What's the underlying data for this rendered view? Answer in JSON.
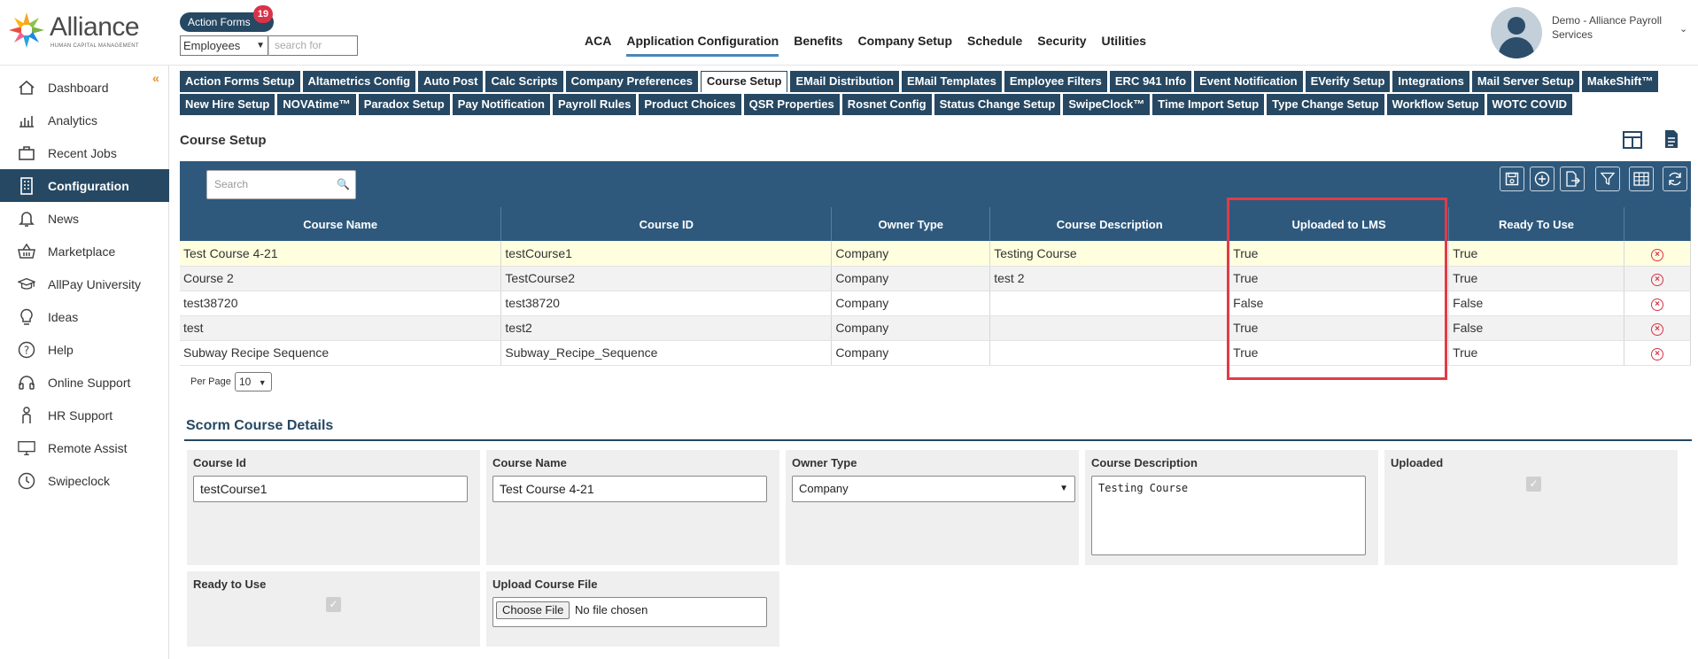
{
  "brand": {
    "name": "Alliance",
    "tagline": "HUMAN CAPITAL MANAGEMENT"
  },
  "header": {
    "action_forms_label": "Action Forms",
    "action_forms_count": "19",
    "employee_select": "Employees",
    "search_placeholder": "search for",
    "nav": [
      "ACA",
      "Application Configuration",
      "Benefits",
      "Company Setup",
      "Schedule",
      "Security",
      "Utilities"
    ],
    "user_name": "Demo - Alliance Payroll Services"
  },
  "sidebar": {
    "items": [
      {
        "label": "Dashboard",
        "icon": "home-icon"
      },
      {
        "label": "Analytics",
        "icon": "analytics-icon"
      },
      {
        "label": "Recent Jobs",
        "icon": "briefcase-icon"
      },
      {
        "label": "Configuration",
        "icon": "building-icon"
      },
      {
        "label": "News",
        "icon": "bell-icon"
      },
      {
        "label": "Marketplace",
        "icon": "basket-icon"
      },
      {
        "label": "AllPay University",
        "icon": "graduation-cap-icon"
      },
      {
        "label": "Ideas",
        "icon": "lightbulb-icon"
      },
      {
        "label": "Help",
        "icon": "question-icon"
      },
      {
        "label": "Online Support",
        "icon": "headset-icon"
      },
      {
        "label": "HR Support",
        "icon": "person-icon"
      },
      {
        "label": "Remote Assist",
        "icon": "monitor-icon"
      },
      {
        "label": "Swipeclock",
        "icon": "clock-icon"
      }
    ]
  },
  "subtabs": {
    "row1": [
      "Action Forms Setup",
      "Altametrics Config",
      "Auto Post",
      "Calc Scripts",
      "Company Preferences",
      "Course Setup",
      "EMail Distribution",
      "EMail Templates",
      "Employee Filters",
      "ERC 941 Info",
      "Event Notification",
      "EVerify Setup",
      "Integrations",
      "Mail Server Setup",
      "MakeShift™"
    ],
    "row2": [
      "New Hire Setup",
      "NOVAtime™",
      "Paradox Setup",
      "Pay Notification",
      "Payroll Rules",
      "Product Choices",
      "QSR Properties",
      "Rosnet Config",
      "Status Change Setup",
      "SwipeClock™",
      "Time Import Setup",
      "Type Change Setup",
      "Workflow Setup",
      "WOTC COVID"
    ]
  },
  "page": {
    "title": "Course Setup"
  },
  "grid": {
    "search_placeholder": "Search",
    "columns": [
      "Course Name",
      "Course ID",
      "Owner Type",
      "Course Description",
      "Uploaded to LMS",
      "Ready To Use"
    ],
    "rows": [
      [
        "Test Course 4-21",
        "testCourse1",
        "Company",
        "Testing Course",
        "True",
        "True"
      ],
      [
        "Course 2",
        "TestCourse2",
        "Company",
        "test 2",
        "True",
        "True"
      ],
      [
        "test38720",
        "test38720",
        "Company",
        "",
        "False",
        "False"
      ],
      [
        "test",
        "test2",
        "Company",
        "",
        "True",
        "False"
      ],
      [
        "Subway Recipe Sequence",
        "Subway_Recipe_Sequence",
        "Company",
        "",
        "True",
        "True"
      ]
    ],
    "per_page_label": "Per Page",
    "per_page_value": "10"
  },
  "scorm": {
    "title": "Scorm Course Details",
    "course_id_label": "Course Id",
    "course_id_value": "testCourse1",
    "course_name_label": "Course Name",
    "course_name_value": "Test Course 4-21",
    "owner_type_label": "Owner Type",
    "owner_type_value": "Company",
    "description_label": "Course Description",
    "description_value": "Testing Course",
    "uploaded_label": "Uploaded",
    "ready_label": "Ready to Use",
    "upload_file_label": "Upload Course File",
    "choose_file_label": "Choose File",
    "no_file_label": "No file chosen"
  },
  "colors": {
    "primary": "#264863",
    "toolbar": "#2e597d",
    "highlight": "#e23b47",
    "badge": "#d9324a"
  }
}
